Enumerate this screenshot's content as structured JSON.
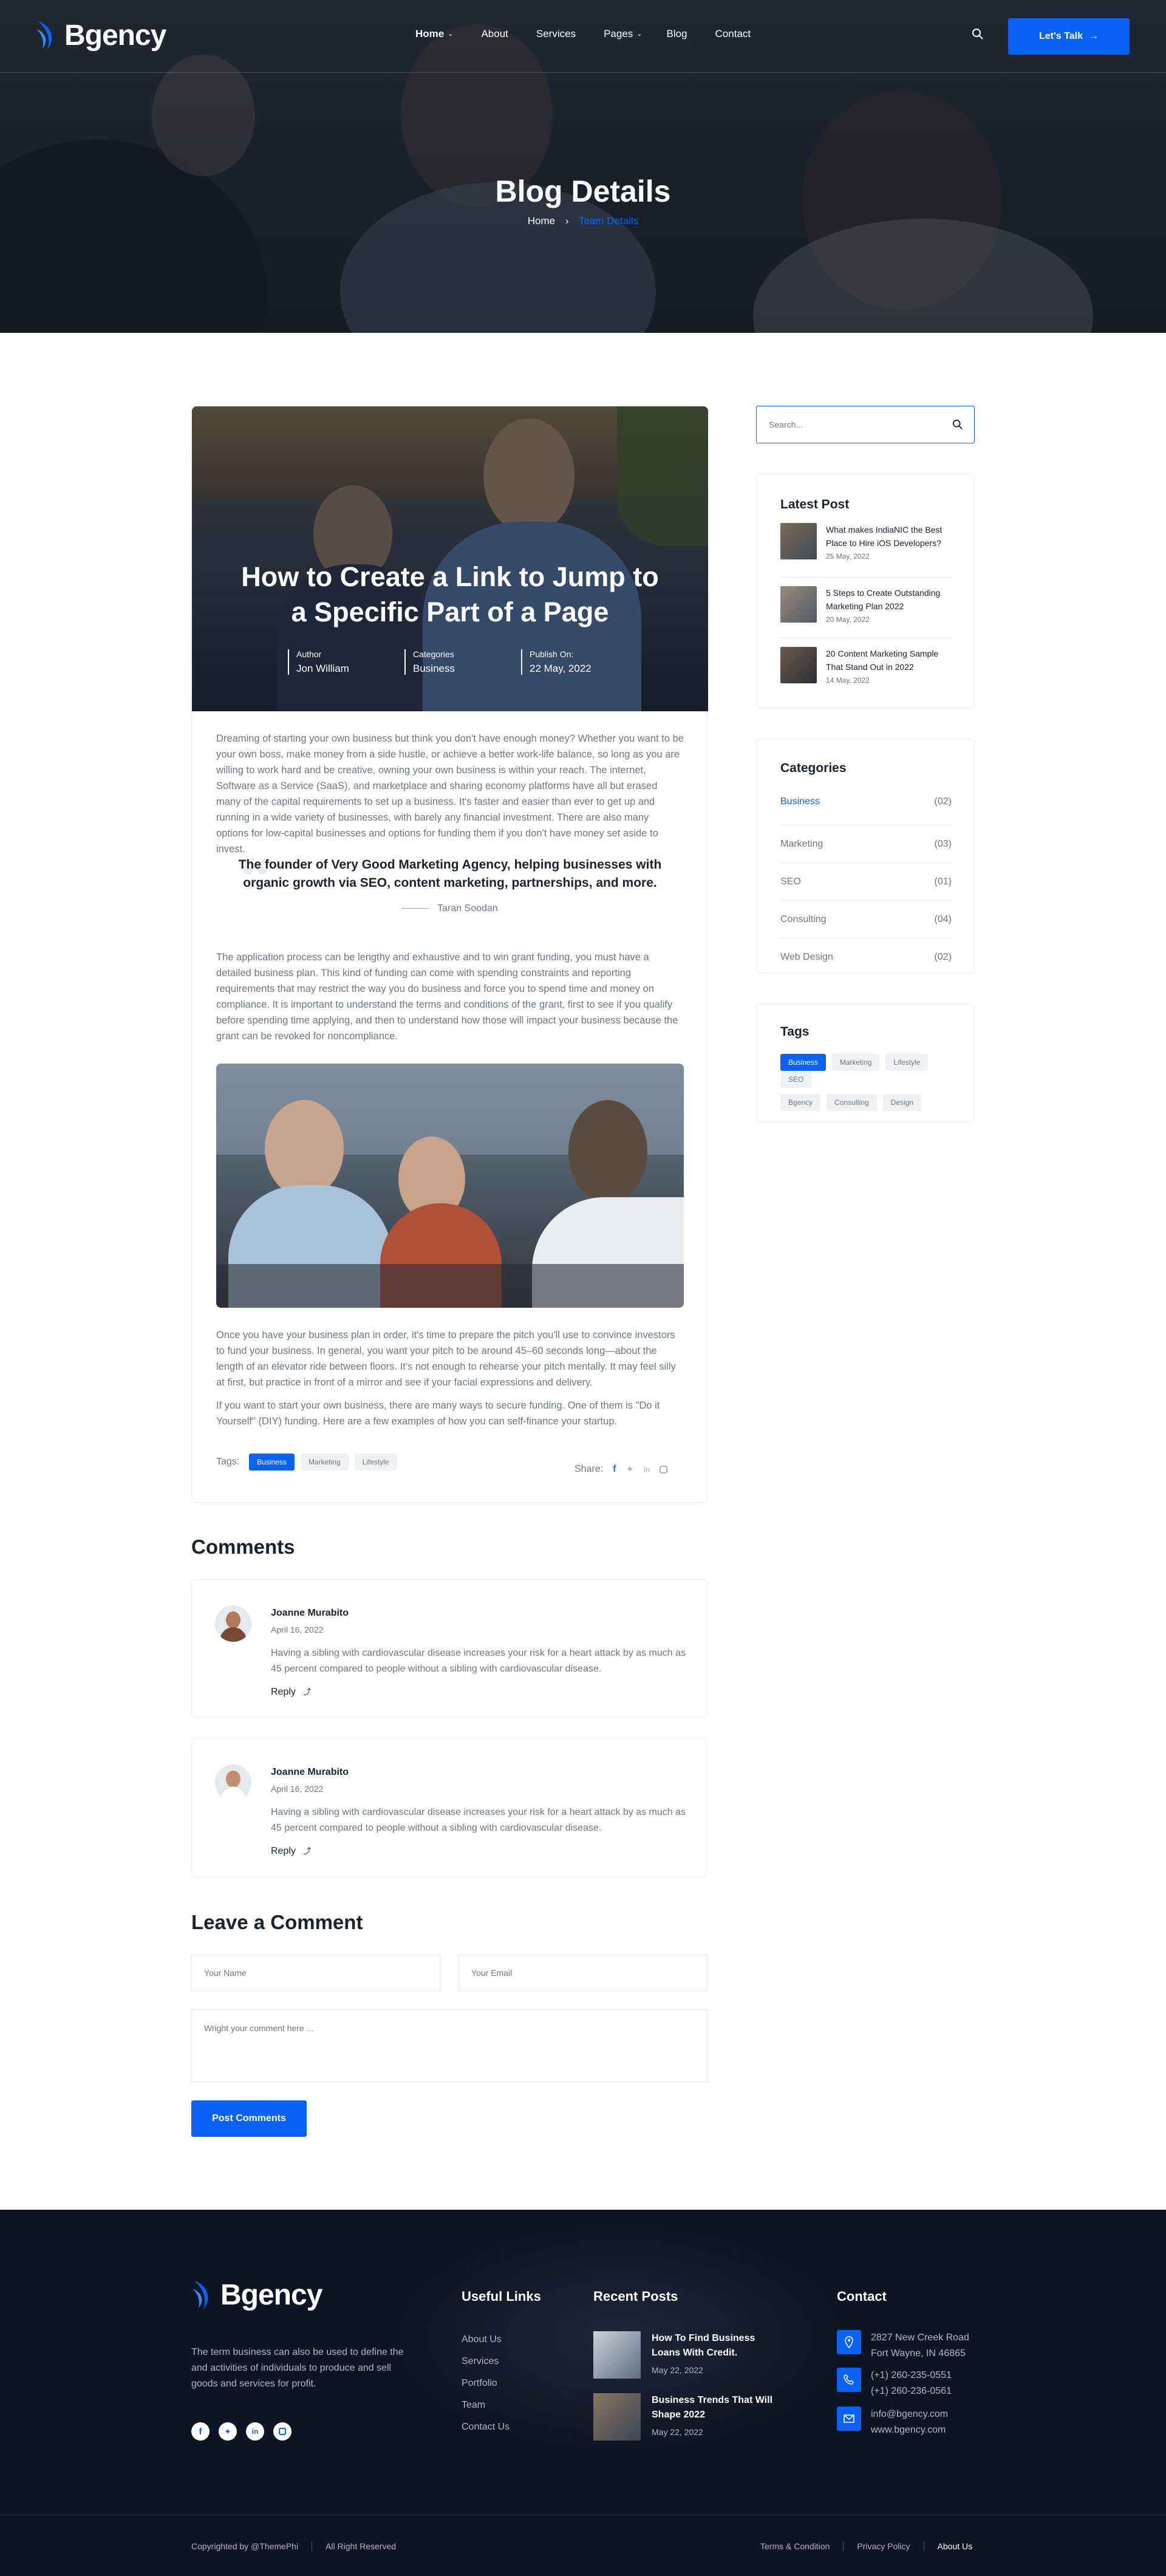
{
  "brand": {
    "name": "Bgency",
    "accent": "#0a63f6",
    "dark": "#0e1524"
  },
  "nav": {
    "items": [
      "Home",
      "About",
      "Services",
      "Pages",
      "Blog",
      "Contact"
    ],
    "cta": "Let's Talk"
  },
  "hero": {
    "title": "Blog Details",
    "crumb_home": "Home",
    "crumb_current": "Team Details"
  },
  "post": {
    "title_line1": "How to Create a Link to Jump to",
    "title_line2": "a Specific Part of a Page",
    "meta": [
      {
        "label": "Author",
        "value": "Jon William"
      },
      {
        "label": "Categories",
        "value": "Business"
      },
      {
        "label": "Publish On:",
        "value": "22 May, 2022"
      }
    ],
    "para1": "Dreaming of starting your own business but think you don't have enough money? Whether you want to be your own boss, make money from a side hustle, or achieve a better work-life balance, so long as you are willing to work hard and be creative, owning your own business is within your reach. The internet, Software as a Service (SaaS), and marketplace and sharing economy platforms have all but erased many of the capital requirements to set up a business. It's faster and easier than ever to get up and running in a wide variety of businesses, with barely any financial investment. There are also many options for low-capital businesses and options for funding them if you don't have money set aside to invest.",
    "quote": "The founder of Very Good Marketing Agency, helping businesses with organic growth via SEO, content marketing, partnerships, and more.",
    "quote_author": "Taran Soodan",
    "para2": "The application process can be lengthy and exhaustive and to win grant funding, you must have a detailed business plan. This kind of funding can come with spending constraints and reporting requirements that may restrict the way you do business and force you to spend time and money on compliance. It is important to understand the terms and conditions of the grant, first to see if you qualify before spending time applying, and then to understand how those will impact your business because the grant can be revoked for noncompliance.",
    "para3": "Once you have your business plan in order, it's time to prepare the pitch you'll use to convince investors to fund your business. In general, you want your pitch to be around 45–60 seconds long—about the length of an elevator ride between floors. It's not enough to rehearse your pitch mentally. It may feel silly at first, but practice in front of a mirror and see if your facial expressions and delivery.",
    "para4": "If you want to start your own business, there are many ways to secure funding. One of them is \"Do it Yourself\" (DIY) funding. Here are a few examples of how you can self-finance your startup.",
    "tags_label": "Tags:",
    "tags": [
      "Business",
      "Marketing",
      "Lifestyle"
    ],
    "share_label": "Share:"
  },
  "comments": {
    "title": "Comments",
    "items": [
      {
        "name": "Joanne Murabito",
        "date": "April 16, 2022",
        "text_line1": "Having a sibling with cardiovascular disease increases your risk for a heart attack by as much as",
        "text_line2": "45 percent compared to people without a sibling with cardiovascular disease.",
        "reply": "Reply"
      },
      {
        "name": "Joanne Murabito",
        "date": "April 16, 2022",
        "text_line1": "Having a sibling with cardiovascular disease increases your risk for a heart attack by as much as",
        "text_line2": "45 percent compared to people without a sibling with cardiovascular disease.",
        "reply": "Reply"
      }
    ]
  },
  "form": {
    "title": "Leave a Comment",
    "name_placeholder": "Your Name",
    "email_placeholder": "Your Email",
    "comment_placeholder": "Wright your comment here ...",
    "submit": "Post Comments"
  },
  "sidebar": {
    "search_placeholder": "Search...",
    "latest_title": "Latest Post",
    "latest": [
      {
        "line1": "What makes IndiaNIC the Best",
        "line2": "Place to Hire iOS Developers?",
        "date": "25 May, 2022"
      },
      {
        "line1": "5 Steps to Create Outstanding",
        "line2": "Marketing Plan 2022",
        "date": "20 May, 2022"
      },
      {
        "line1": "20 Content Marketing Sample",
        "line2": "That Stand Out in 2022",
        "date": "14 May, 2022"
      }
    ],
    "categories_title": "Categories",
    "categories": [
      {
        "name": "Business",
        "count": "(02)"
      },
      {
        "name": "Marketing",
        "count": "(03)"
      },
      {
        "name": "SEO",
        "count": "(01)"
      },
      {
        "name": "Consulting",
        "count": "(04)"
      },
      {
        "name": "Web Design",
        "count": "(02)"
      }
    ],
    "tags_title": "Tags",
    "tags_row1": [
      "Business",
      "Marketing",
      "Lifestyle",
      "SEO"
    ],
    "tags_row2": [
      "Bgency",
      "Consulting",
      "Design"
    ]
  },
  "footer": {
    "about": [
      "The term business can also be used to define the",
      "and activities of individuals to produce and sell",
      "goods and services for profit."
    ],
    "useful_title": "Useful Links",
    "useful": [
      "About Us",
      "Services",
      "Portfolio",
      "Team",
      "Contact Us"
    ],
    "recent_title": "Recent Posts",
    "recent": [
      {
        "line1": "How To Find Business",
        "line2": "Loans With Credit.",
        "date": "May 22, 2022"
      },
      {
        "line1": "Business Trends That Will",
        "line2": "Shape 2022",
        "date": "May 22, 2022"
      }
    ],
    "contact_title": "Contact",
    "address": [
      "2827 New Creek Road",
      "Fort Wayne, IN 46865"
    ],
    "phones": [
      "(+1) 260-235-0551",
      "(+1) 260-236-0561"
    ],
    "emails": [
      "info@bgency.com",
      "www.bgency.com"
    ],
    "copyright": "Copyrighted by @ThemePhi",
    "rights": "All Right Reserved",
    "bottom_links": [
      "Terms & Condition",
      "Privacy Policy",
      "About Us"
    ]
  }
}
